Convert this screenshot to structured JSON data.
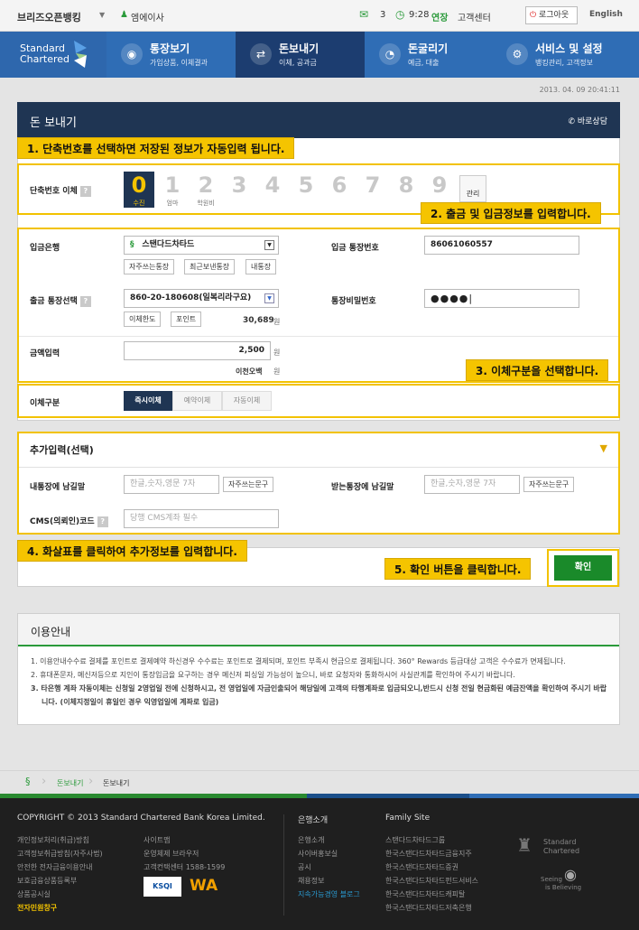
{
  "topbar": {
    "bank_name": "브리즈오픈뱅킹",
    "user_name": "엠에이사",
    "mail_count": "3",
    "timer": "9:28",
    "extend": "연장",
    "customer_center": "고객센터",
    "logout": "로그아웃",
    "language": "English"
  },
  "brand": {
    "line1": "Standard",
    "line2": "Chartered"
  },
  "gnb": [
    {
      "title": "통장보기",
      "sub": "가입상품, 이체결과",
      "icon": "eye-icon"
    },
    {
      "title": "돈보내기",
      "sub": "이체, 공과금",
      "icon": "transfer-icon"
    },
    {
      "title": "돈굴리기",
      "sub": "예금, 대출",
      "icon": "growth-icon"
    },
    {
      "title": "서비스 및 설정",
      "sub": "뱅킹관리, 고객정보",
      "icon": "gear-icon"
    }
  ],
  "datetime": "2013. 04. 09 20:41:11",
  "section": {
    "title": "돈 보내기",
    "consult": "바로상담"
  },
  "callouts": {
    "c1": "1. 단축번호를 선택하면 저장된 정보가 자동입력 됩니다.",
    "c2": "2. 출금 및 입금정보를 입력합니다.",
    "c3": "3. 이체구분을 선택합니다.",
    "c4": "4. 화살표를 클릭하여 추가정보를 입력합니다.",
    "c5": "5. 확인 버튼을 클릭합니다."
  },
  "speed": {
    "label": "단축번호 이체",
    "numbers": [
      {
        "d": "0",
        "s": "수진"
      },
      {
        "d": "1",
        "s": "엄마"
      },
      {
        "d": "2",
        "s": "학원비"
      },
      {
        "d": "3",
        "s": ""
      },
      {
        "d": "4",
        "s": ""
      },
      {
        "d": "5",
        "s": ""
      },
      {
        "d": "6",
        "s": ""
      },
      {
        "d": "7",
        "s": ""
      },
      {
        "d": "8",
        "s": ""
      },
      {
        "d": "9",
        "s": ""
      }
    ],
    "manage": "관리"
  },
  "form": {
    "in_bank_label": "입금은행",
    "in_bank_value": "스탠다드차타드",
    "in_bank_btns": [
      "자주쓰는통장",
      "최근보낸통장",
      "내통장"
    ],
    "in_account_label": "입금 통장번호",
    "in_account_value": "86061060557",
    "out_account_label": "출금 통장선택",
    "out_account_value": "860-20-180608(일복리라구요)",
    "out_btns": [
      "이체한도",
      "포인트"
    ],
    "balance": "30,689",
    "won": "원",
    "password_label": "통장비밀번호",
    "password_value": "●●●●|",
    "amount_label": "금액입력",
    "amount_value": "2,500",
    "amount_korean": "이천오백"
  },
  "transfer_type": {
    "label": "이체구분",
    "tabs": [
      "즉시이체",
      "예약이체",
      "자동이체"
    ]
  },
  "extra": {
    "title": "추가입력(선택)",
    "my_memo_label": "내통장에 남길말",
    "my_memo_placeholder": "한글,숫자,영문 7자",
    "recv_memo_label": "받는통장에 남길말",
    "recv_memo_placeholder": "한글,숫자,영문 7자",
    "phrase_btn": "자주쓰는문구",
    "cms_label": "CMS(의뢰인)코드",
    "cms_placeholder": "당행 CMS계좌 필수"
  },
  "confirm": "확인",
  "guide": {
    "title": "이용안내",
    "items": [
      "1.  이용안내수수료 결제를 포인트로 결제예약 하신경우 수수료는 포인트로 결제되며, 포인트 부족시 현금으로 결제됩니다. 360° Rewards 등급대상 고객은 수수료가 면제됩니다.",
      "2.  휴대폰문자, 메신저등으로 지인이 통장입금을 요구하는 경우 메신저 피싱일 가능성이 높으니, 바로 요청자와 통화하시어 사실관계를 확인하여 주시기 바랍니다.",
      "3.  타은행 계좌 자동이체는 신청일 2영업일 전에 신청하시고, 전 영업일에 자금인출되어 해당일에 고객의 타행계좌로 입금되오니,반드시 신청 전일 현금화된 예금잔액을 확인하여 주시기 바랍니다. (이체지정일이 휴일인 경우 익영업일에 계좌로 입금)"
    ]
  },
  "breadcrumb": [
    "돈보내기",
    "돈보내기"
  ],
  "footer": {
    "copyright": "COPYRIGHT © 2013 Standard Chartered Bank Korea Limited.",
    "col1": [
      "개인정보처리(취급)방침",
      "고객정보취급방침(자주사법)",
      "안전한 전자금융이용안내",
      "보호금융상품등록부",
      "상품공시실",
      "전자민원창구"
    ],
    "col2": [
      "사이트맵",
      "운영체제 브라우저",
      "고객컨택센터 1588-1599"
    ],
    "col3_title": "은행소개",
    "col3": [
      "은행소개",
      "사이버홍보실",
      "공시",
      "채용정보",
      "지속가능경영 블로그"
    ],
    "col4_title": "Family Site",
    "col4": [
      "스탠다드차타드그룹",
      "한국스탠다드차타드금융지주",
      "한국스탠다드차타드증권",
      "한국스탠다드차타드펀드서비스",
      "한국스탠다드차타드캐피탈",
      "한국스탠다드차타드저축은행"
    ],
    "badge_ksqi": "KSQI",
    "badge_wa": "WA",
    "sc_line1": "Standard",
    "sc_line2": "Chartered",
    "seeing1": "Seeing",
    "seeing2": "is Believing"
  },
  "colors": {
    "gnb": "#2f6db5",
    "gnb_active": "#1c3d70",
    "highlight": "#f2c200",
    "confirm": "#1a8a2a",
    "section_header": "#1f3553"
  }
}
